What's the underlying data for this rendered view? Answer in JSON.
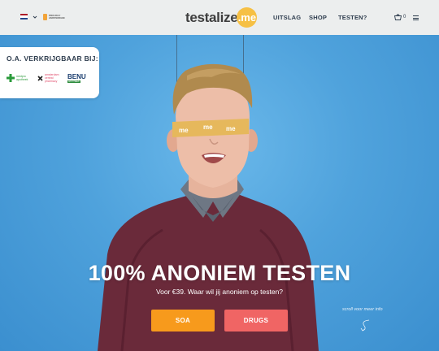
{
  "header": {
    "language": {
      "flag_colors": [
        "#ae1c28",
        "#ffffff",
        "#21468b"
      ],
      "icon": "chevron-down-icon"
    },
    "badge": {
      "text": "PROUDLY AMSTERDAM"
    },
    "logo": {
      "main": "testalize",
      "suffix": ".me",
      "accent": "#f6c044"
    },
    "nav": [
      {
        "label": "UITSLAG"
      },
      {
        "label": "SHOP"
      },
      {
        "label": "TESTEN?"
      }
    ],
    "cart": {
      "count": "0",
      "icon": "basket-icon"
    },
    "menu_icon": "hamburger-icon"
  },
  "retail": {
    "title": "O.A. VERKRIJGBAAR BIJ:",
    "stores": [
      {
        "name": "medpro apotheek",
        "color": "#2a9a3a"
      },
      {
        "name": "amsterdam central pharmacy",
        "color": "#e04a6a"
      },
      {
        "name": "BENU",
        "sub": "APOTHEEK"
      }
    ]
  },
  "hero": {
    "tape_text": "me",
    "headline": "100% ANONIEM TESTEN",
    "subline": "Voor €39. Waar wil jij anoniem op testen?",
    "buttons": [
      {
        "label": "SOA",
        "color": "#f79a1c"
      },
      {
        "label": "DRUGS",
        "color": "#f06564"
      }
    ],
    "scroll_hint": "scroll voor meer info"
  }
}
